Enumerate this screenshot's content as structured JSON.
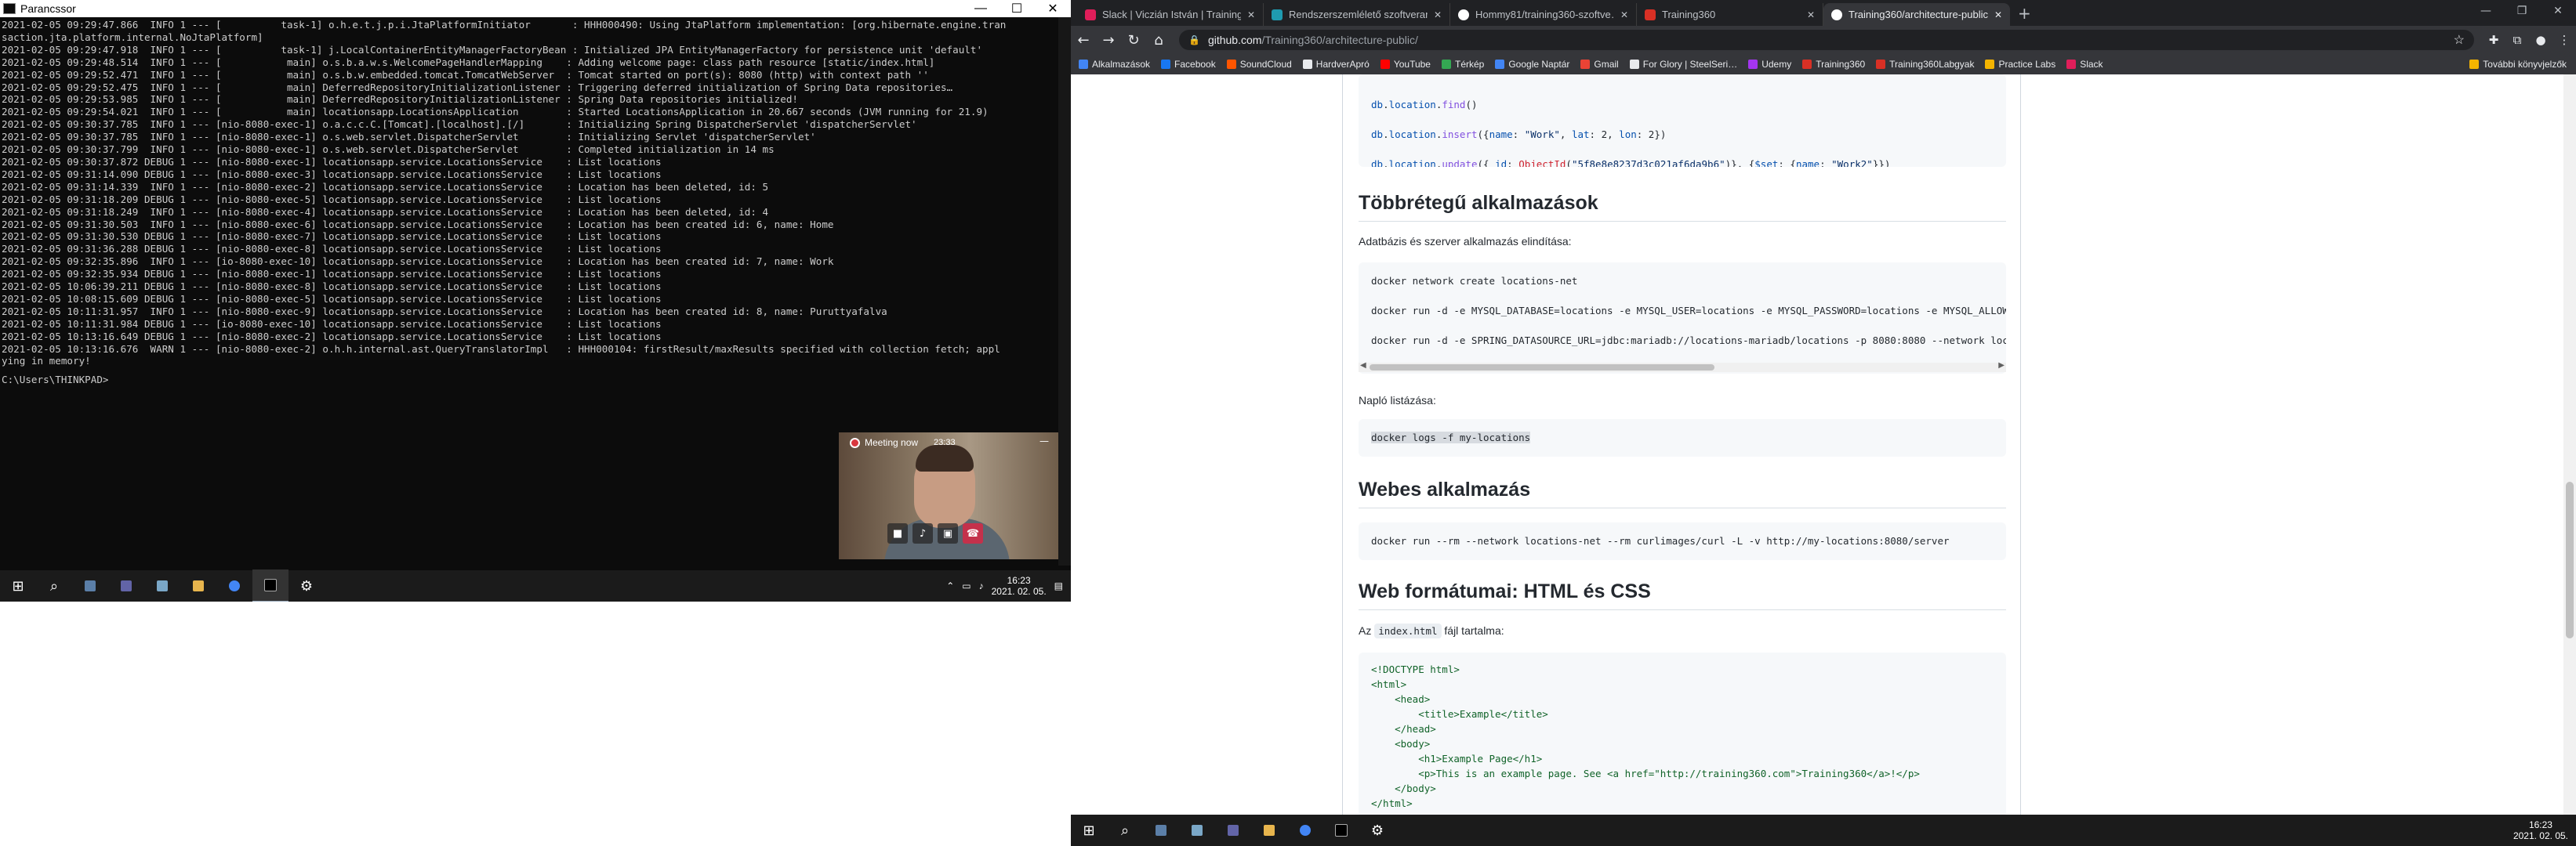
{
  "cmd": {
    "title": "Parancssor",
    "controls": [
      "—",
      "☐",
      "✕"
    ],
    "log_lines": [
      "2021-02-05 09:29:47.866  INFO 1 --- [          task-1] o.h.e.t.j.p.i.JtaPlatformInitiator       : HHH000490: Using JtaPlatform implementation: [org.hibernate.engine.tran",
      "saction.jta.platform.internal.NoJtaPlatform]",
      "2021-02-05 09:29:47.918  INFO 1 --- [          task-1] j.LocalContainerEntityManagerFactoryBean : Initialized JPA EntityManagerFactory for persistence unit 'default'",
      "2021-02-05 09:29:48.514  INFO 1 --- [           main] o.s.b.a.w.s.WelcomePageHandlerMapping    : Adding welcome page: class path resource [static/index.html]",
      "2021-02-05 09:29:52.471  INFO 1 --- [           main] o.s.b.w.embedded.tomcat.TomcatWebServer  : Tomcat started on port(s): 8080 (http) with context path ''",
      "2021-02-05 09:29:52.475  INFO 1 --- [           main] DeferredRepositoryInitializationListener : Triggering deferred initialization of Spring Data repositories…",
      "2021-02-05 09:29:53.985  INFO 1 --- [           main] DeferredRepositoryInitializationListener : Spring Data repositories initialized!",
      "2021-02-05 09:29:54.021  INFO 1 --- [           main] locationsapp.LocationsApplication        : Started LocationsApplication in 20.667 seconds (JVM running for 21.9)",
      "2021-02-05 09:30:37.785  INFO 1 --- [nio-8080-exec-1] o.a.c.c.C.[Tomcat].[localhost].[/]       : Initializing Spring DispatcherServlet 'dispatcherServlet'",
      "2021-02-05 09:30:37.785  INFO 1 --- [nio-8080-exec-1] o.s.web.servlet.DispatcherServlet        : Initializing Servlet 'dispatcherServlet'",
      "2021-02-05 09:30:37.799  INFO 1 --- [nio-8080-exec-1] o.s.web.servlet.DispatcherServlet        : Completed initialization in 14 ms",
      "2021-02-05 09:30:37.872 DEBUG 1 --- [nio-8080-exec-1] locationsapp.service.LocationsService    : List locations",
      "2021-02-05 09:31:14.090 DEBUG 1 --- [nio-8080-exec-3] locationsapp.service.LocationsService    : List locations",
      "2021-02-05 09:31:14.339  INFO 1 --- [nio-8080-exec-2] locationsapp.service.LocationsService    : Location has been deleted, id: 5",
      "2021-02-05 09:31:18.209 DEBUG 1 --- [nio-8080-exec-5] locationsapp.service.LocationsService    : List locations",
      "2021-02-05 09:31:18.249  INFO 1 --- [nio-8080-exec-4] locationsapp.service.LocationsService    : Location has been deleted, id: 4",
      "2021-02-05 09:31:30.503  INFO 1 --- [nio-8080-exec-6] locationsapp.service.LocationsService    : Location has been created id: 6, name: Home",
      "2021-02-05 09:31:30.530 DEBUG 1 --- [nio-8080-exec-7] locationsapp.service.LocationsService    : List locations",
      "2021-02-05 09:31:36.288 DEBUG 1 --- [nio-8080-exec-8] locationsapp.service.LocationsService    : List locations",
      "2021-02-05 09:32:35.896  INFO 1 --- [io-8080-exec-10] locationsapp.service.LocationsService    : Location has been created id: 7, name: Work",
      "2021-02-05 09:32:35.934 DEBUG 1 --- [nio-8080-exec-1] locationsapp.service.LocationsService    : List locations",
      "2021-02-05 10:06:39.211 DEBUG 1 --- [nio-8080-exec-8] locationsapp.service.LocationsService    : List locations",
      "2021-02-05 10:08:15.609 DEBUG 1 --- [nio-8080-exec-5] locationsapp.service.LocationsService    : List locations",
      "2021-02-05 10:11:31.957  INFO 1 --- [nio-8080-exec-9] locationsapp.service.LocationsService    : Location has been created id: 8, name: Puruttyafalva",
      "2021-02-05 10:11:31.984 DEBUG 1 --- [io-8080-exec-10] locationsapp.service.LocationsService    : List locations",
      "2021-02-05 10:13:16.649 DEBUG 1 --- [nio-8080-exec-2] locationsapp.service.LocationsService    : List locations",
      "2021-02-05 10:13:16.676  WARN 1 --- [nio-8080-exec-2] o.h.h.internal.ast.QueryTranslatorImpl   : HHH000104: firstResult/maxResults specified with collection fetch; appl",
      "ying in memory!"
    ],
    "prompt": "C:\\Users\\THINKPAD>"
  },
  "meeting": {
    "status": "Meeting now",
    "time": "23:33",
    "close": "—"
  },
  "taskbar_left": {
    "time": "16:23",
    "date": "2021. 02. 05."
  },
  "taskbar_right": {
    "time": "16:23",
    "date": "2021. 02. 05."
  },
  "chrome": {
    "tabs": [
      {
        "title": "Slack | Viczián István | Training360",
        "color": "#e01e5a"
      },
      {
        "title": "Rendszerszemlélető szoftverarc",
        "color": "#1f9bb0"
      },
      {
        "title": "Hommy81/training360-szoftve…",
        "color": "#ffffff"
      },
      {
        "title": "Training360",
        "color": "#d93025"
      },
      {
        "title": "Training360/architecture-public",
        "color": "#ffffff"
      }
    ],
    "new_tab": "+",
    "url_host": "github.com",
    "url_path": "/Training360/architecture-public/",
    "bookmarks": [
      {
        "label": "Alkalmazások",
        "color": "#4285f4"
      },
      {
        "label": "Facebook",
        "color": "#1877f2"
      },
      {
        "label": "SoundCloud",
        "color": "#ff5500"
      },
      {
        "label": "HardverApró",
        "color": "#e8eaed"
      },
      {
        "label": "YouTube",
        "color": "#ff0000"
      },
      {
        "label": "Térkép",
        "color": "#34a853"
      },
      {
        "label": "Google Naptár",
        "color": "#4285f4"
      },
      {
        "label": "Gmail",
        "color": "#ea4335"
      },
      {
        "label": "For Glory | SteelSeri…",
        "color": "#e8eaed"
      },
      {
        "label": "Udemy",
        "color": "#a435f0"
      },
      {
        "label": "Training360",
        "color": "#d93025"
      },
      {
        "label": "Training360Labgyak",
        "color": "#d93025"
      },
      {
        "label": "Practice Labs",
        "color": "#f4b400"
      },
      {
        "label": "Slack",
        "color": "#e01e5a"
      }
    ],
    "bookmarks_other": "További könyvjelzők"
  },
  "article": {
    "mongo_code": [
      "db.location.find()",
      "db.location.insert({name: \"Work\", lat: 2, lon: 2})",
      "db.location.update({_id: ObjectId(\"5f8e8e8237d3c021af6da9b6\")}, {$set: {name: \"Work2\"}})"
    ],
    "h_multitier": "Többrétegű alkalmazások",
    "p_multitier": "Adatbázis és szerver alkalmazás elindítása:",
    "docker_code": [
      "docker network create locations-net",
      "docker run -d -e MYSQL_DATABASE=locations -e MYSQL_USER=locations -e MYSQL_PASSWORD=locations -e MYSQL_ALLOW_E",
      "docker run -d -e SPRING_DATASOURCE_URL=jdbc:mariadb://locations-mariadb/locations -p 8080:8080 --network locat"
    ],
    "p_log": "Napló listázása:",
    "log_code": "docker logs -f my-locations",
    "h_web": "Webes alkalmazás",
    "web_code": "docker run --rm --network locations-net --rm curlimages/curl -L -v http://my-locations:8080/server",
    "h_formats": "Web formátumai: HTML és CSS",
    "p_index_pre": "Az",
    "p_index_code": "index.html",
    "p_index_post": "fájl tartalma:",
    "html_code": [
      "<!DOCTYPE html>",
      "<html>",
      "    <head>",
      "        <title>Example</title>",
      "    </head>",
      "    <body>",
      "        <h1>Example Page</h1>",
      "        <p>This is an example page. See <a href=\"http://training360.com\">Training360</a>!</p>",
      "    </body>",
      "</html>"
    ]
  }
}
